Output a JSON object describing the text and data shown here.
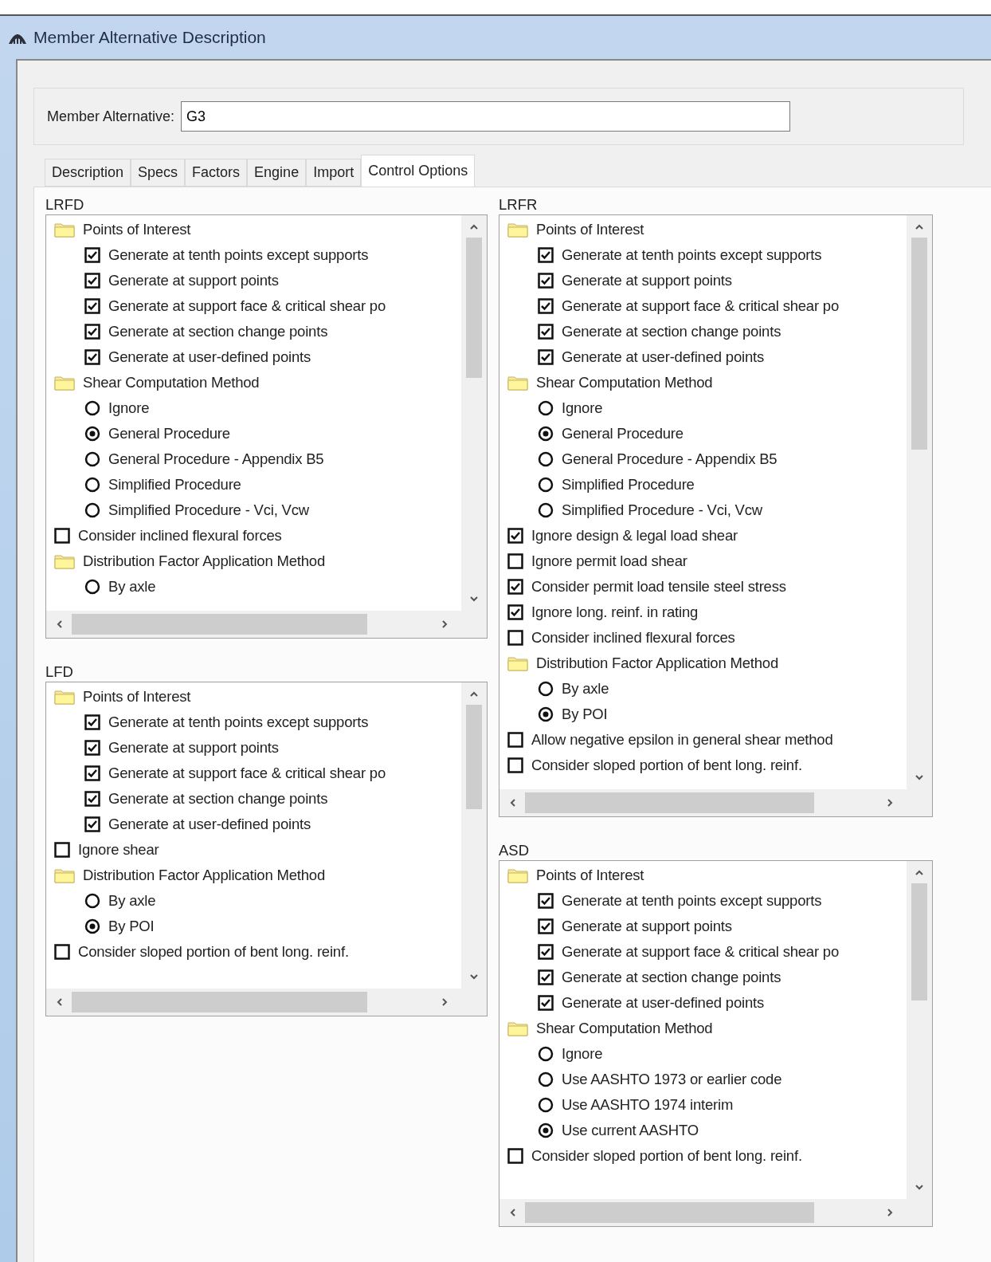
{
  "window": {
    "title": "Member Alternative Description"
  },
  "member_alternative": {
    "label": "Member Alternative:",
    "value": "G3"
  },
  "tabs": [
    {
      "label": "Description",
      "selected": false
    },
    {
      "label": "Specs",
      "selected": false
    },
    {
      "label": "Factors",
      "selected": false
    },
    {
      "label": "Engine",
      "selected": false
    },
    {
      "label": "Import",
      "selected": false
    },
    {
      "label": "Control Options",
      "selected": true
    }
  ],
  "panels": [
    {
      "title": "LRFD",
      "items": [
        {
          "kind": "folder",
          "label": "Points of Interest",
          "children": [
            {
              "kind": "checkbox",
              "label": "Generate at tenth points except supports",
              "checked": true
            },
            {
              "kind": "checkbox",
              "label": "Generate at support points",
              "checked": true
            },
            {
              "kind": "checkbox",
              "label": "Generate at support face & critical shear po",
              "checked": true
            },
            {
              "kind": "checkbox",
              "label": "Generate at section change points",
              "checked": true
            },
            {
              "kind": "checkbox",
              "label": "Generate at user-defined points",
              "checked": true
            }
          ]
        },
        {
          "kind": "folder",
          "label": "Shear Computation Method",
          "children": [
            {
              "kind": "radio",
              "label": "Ignore",
              "selected": false
            },
            {
              "kind": "radio",
              "label": "General Procedure",
              "selected": true
            },
            {
              "kind": "radio",
              "label": "General Procedure - Appendix B5",
              "selected": false
            },
            {
              "kind": "radio",
              "label": "Simplified Procedure",
              "selected": false
            },
            {
              "kind": "radio",
              "label": "Simplified Procedure - Vci, Vcw",
              "selected": false
            }
          ]
        },
        {
          "kind": "checkbox",
          "label": "Consider inclined flexural forces",
          "checked": false
        },
        {
          "kind": "folder",
          "label": "Distribution Factor Application Method",
          "children": [
            {
              "kind": "radio",
              "label": "By axle",
              "selected": false
            }
          ]
        }
      ]
    },
    {
      "title": "LFD",
      "items": [
        {
          "kind": "folder",
          "label": "Points of Interest",
          "children": [
            {
              "kind": "checkbox",
              "label": "Generate at tenth points except supports",
              "checked": true
            },
            {
              "kind": "checkbox",
              "label": "Generate at support points",
              "checked": true
            },
            {
              "kind": "checkbox",
              "label": "Generate at support face & critical shear po",
              "checked": true
            },
            {
              "kind": "checkbox",
              "label": "Generate at section change points",
              "checked": true
            },
            {
              "kind": "checkbox",
              "label": "Generate at user-defined points",
              "checked": true
            }
          ]
        },
        {
          "kind": "checkbox",
          "label": "Ignore shear",
          "checked": false
        },
        {
          "kind": "folder",
          "label": "Distribution Factor Application Method",
          "children": [
            {
              "kind": "radio",
              "label": "By axle",
              "selected": false
            },
            {
              "kind": "radio",
              "label": "By POI",
              "selected": true
            }
          ]
        },
        {
          "kind": "checkbox",
          "label": "Consider sloped portion of bent long. reinf.",
          "checked": false
        }
      ]
    },
    {
      "title": "LRFR",
      "items": [
        {
          "kind": "folder",
          "label": "Points of Interest",
          "children": [
            {
              "kind": "checkbox",
              "label": "Generate at tenth points except supports",
              "checked": true
            },
            {
              "kind": "checkbox",
              "label": "Generate at support points",
              "checked": true
            },
            {
              "kind": "checkbox",
              "label": "Generate at support face & critical shear po",
              "checked": true
            },
            {
              "kind": "checkbox",
              "label": "Generate at section change points",
              "checked": true
            },
            {
              "kind": "checkbox",
              "label": "Generate at user-defined points",
              "checked": true
            }
          ]
        },
        {
          "kind": "folder",
          "label": "Shear Computation Method",
          "children": [
            {
              "kind": "radio",
              "label": "Ignore",
              "selected": false
            },
            {
              "kind": "radio",
              "label": "General Procedure",
              "selected": true
            },
            {
              "kind": "radio",
              "label": "General Procedure - Appendix B5",
              "selected": false
            },
            {
              "kind": "radio",
              "label": "Simplified Procedure",
              "selected": false
            },
            {
              "kind": "radio",
              "label": "Simplified Procedure - Vci, Vcw",
              "selected": false
            }
          ]
        },
        {
          "kind": "checkbox",
          "label": "Ignore design & legal load shear",
          "checked": true
        },
        {
          "kind": "checkbox",
          "label": "Ignore permit load shear",
          "checked": false
        },
        {
          "kind": "checkbox",
          "label": "Consider permit load tensile steel stress",
          "checked": true
        },
        {
          "kind": "checkbox",
          "label": "Ignore long. reinf. in rating",
          "checked": true
        },
        {
          "kind": "checkbox",
          "label": "Consider inclined flexural forces",
          "checked": false
        },
        {
          "kind": "folder",
          "label": "Distribution Factor Application Method",
          "children": [
            {
              "kind": "radio",
              "label": "By axle",
              "selected": false
            },
            {
              "kind": "radio",
              "label": "By POI",
              "selected": true
            }
          ]
        },
        {
          "kind": "checkbox",
          "label": "Allow negative epsilon in general shear method",
          "checked": false
        },
        {
          "kind": "checkbox",
          "label": "Consider sloped portion of bent long. reinf.",
          "checked": false
        }
      ]
    },
    {
      "title": "ASD",
      "items": [
        {
          "kind": "folder",
          "label": "Points of Interest",
          "children": [
            {
              "kind": "checkbox",
              "label": "Generate at tenth points except supports",
              "checked": true
            },
            {
              "kind": "checkbox",
              "label": "Generate at support points",
              "checked": true
            },
            {
              "kind": "checkbox",
              "label": "Generate at support face & critical shear po",
              "checked": true
            },
            {
              "kind": "checkbox",
              "label": "Generate at section change points",
              "checked": true
            },
            {
              "kind": "checkbox",
              "label": "Generate at user-defined points",
              "checked": true
            }
          ]
        },
        {
          "kind": "folder",
          "label": "Shear Computation Method",
          "children": [
            {
              "kind": "radio",
              "label": "Ignore",
              "selected": false
            },
            {
              "kind": "radio",
              "label": "Use AASHTO 1973 or earlier code",
              "selected": false
            },
            {
              "kind": "radio",
              "label": "Use AASHTO 1974 interim",
              "selected": false
            },
            {
              "kind": "radio",
              "label": "Use current AASHTO",
              "selected": true
            }
          ]
        },
        {
          "kind": "checkbox",
          "label": "Consider sloped portion of bent long. reinf.",
          "checked": false
        }
      ]
    }
  ]
}
